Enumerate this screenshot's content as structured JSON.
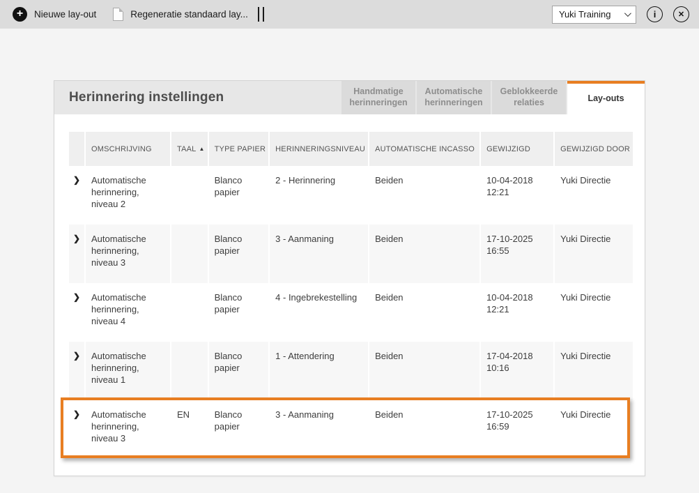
{
  "toolbar": {
    "new_layout_label": "Nieuwe lay-out",
    "regenerate_label": "Regeneratie standaard lay...",
    "company_select": {
      "value": "Yuki Training"
    }
  },
  "icons": {
    "plus": "+",
    "info": "i",
    "close": "✕",
    "sort_asc": "▲",
    "expand_chevron": "❯"
  },
  "panel": {
    "title": "Herinnering instellingen",
    "tabs": [
      {
        "label": "Handmatige herinneringen",
        "active": false
      },
      {
        "label": "Automatische herinneringen",
        "active": false
      },
      {
        "label": "Geblokkeerde relaties",
        "active": false
      },
      {
        "label": "Lay-outs",
        "active": true
      }
    ]
  },
  "table": {
    "columns": {
      "omschrijving": "OMSCHRIJVING",
      "taal": "TAAL",
      "type_papier": "TYPE PAPIER",
      "herinneringsniveau": "HERINNERINGSNIVEAU",
      "automatische_incasso": "AUTOMATISCHE INCASSO",
      "gewijzigd": "GEWIJZIGD",
      "gewijzigd_door": "GEWIJZIGD DOOR"
    },
    "sort": {
      "column": "TAAL",
      "direction": "ascending"
    },
    "rows": [
      {
        "omschrijving": "Automatische herinnering, niveau 2",
        "taal": "",
        "type_papier": "Blanco papier",
        "herinneringsniveau": "2 - Herinnering",
        "automatische_incasso": "Beiden",
        "gewijzigd": "10-04-2018 12:21",
        "gewijzigd_door": "Yuki Directie",
        "highlighted": false
      },
      {
        "omschrijving": "Automatische herinnering, niveau 3",
        "taal": "",
        "type_papier": "Blanco papier",
        "herinneringsniveau": "3 - Aanmaning",
        "automatische_incasso": "Beiden",
        "gewijzigd": "17-10-2025 16:55",
        "gewijzigd_door": "Yuki Directie",
        "highlighted": false
      },
      {
        "omschrijving": "Automatische herinnering, niveau 4",
        "taal": "",
        "type_papier": "Blanco papier",
        "herinneringsniveau": "4 - Ingebrekestelling",
        "automatische_incasso": "Beiden",
        "gewijzigd": "10-04-2018 12:21",
        "gewijzigd_door": "Yuki Directie",
        "highlighted": false
      },
      {
        "omschrijving": "Automatische herinnering, niveau 1",
        "taal": "",
        "type_papier": "Blanco papier",
        "herinneringsniveau": "1 - Attendering",
        "automatische_incasso": "Beiden",
        "gewijzigd": "17-04-2018 10:16",
        "gewijzigd_door": "Yuki Directie",
        "highlighted": false
      },
      {
        "omschrijving": "Automatische herinnering, niveau 3",
        "taal": "EN",
        "type_papier": "Blanco papier",
        "herinneringsniveau": "3 - Aanmaning",
        "automatische_incasso": "Beiden",
        "gewijzigd": "17-10-2025 16:59",
        "gewijzigd_door": "Yuki Directie",
        "highlighted": true
      }
    ]
  },
  "colors": {
    "accent_orange": "#e87e22",
    "toolbar_bg": "#dcdcdc",
    "page_bg": "#f4f4f4",
    "stripe_bg": "#f7f7f7"
  }
}
